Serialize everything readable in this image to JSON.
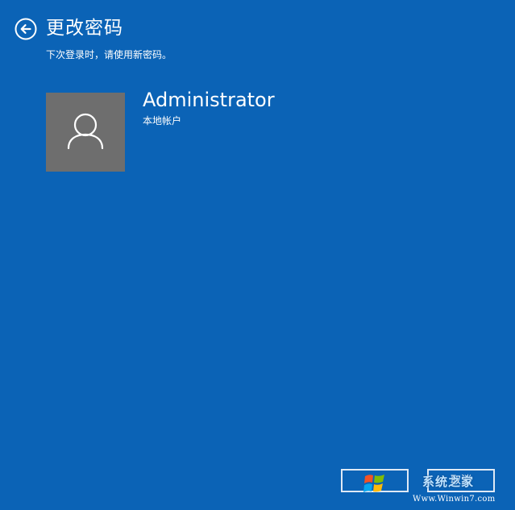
{
  "header": {
    "back_icon": "back-arrow-circle-icon",
    "title": "更改密码",
    "subtitle": "下次登录时，请使用新密码。"
  },
  "account": {
    "avatar_icon": "user-silhouette-icon",
    "name": "Administrator",
    "type": "本地帐户"
  },
  "footer": {
    "next_label": "",
    "cancel_label": "取消"
  },
  "watermark": {
    "logo_icon": "windows-logo-icon",
    "text": "系统之家",
    "url": "Www.Winwin7.com"
  },
  "colors": {
    "background": "#0b63b6",
    "avatar_bg": "#6e6e6e",
    "text": "#ffffff",
    "button_border": "#dfe9f5"
  }
}
